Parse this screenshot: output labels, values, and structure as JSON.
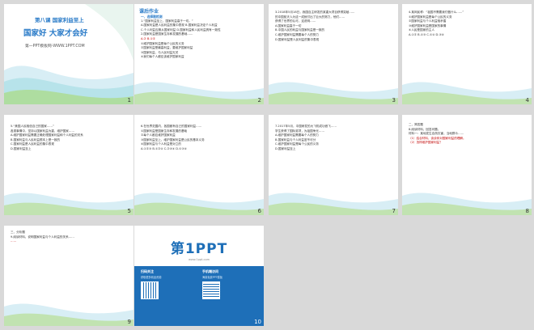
{
  "slides": [
    {
      "num": "1",
      "lesson": "第八课  国家利益至上",
      "title": "国家好  大家才会好",
      "footer": "第一PPT模板网-WWW.1PPT.COM"
    },
    {
      "num": "2",
      "section": "课后作业",
      "sub": "一、选择题检测",
      "lines": [
        "1.“国家利益至上，国家利益高于一切。”",
        "A.国家利益是人民利益的集中表现   B.国家利益决定个人利益",
        "C.个人利益应服从国家利益   D.国家利益和人民利益具有一致性",
        "2.国家利益是国家生存和发展的基础……",
        "A.②   B.①②",
        "①维护国家利益是每个公民的义务",
        "②国家利益是最高利益，要维护国家利益",
        "③国家利益，与人民利益无关",
        "④我们每个人都应该维护国家利益"
      ]
    },
    {
      "num": "3",
      "lines": [
        "3.2018年5月18日，我国自主研发的某重大项目获得突破……",
        "的中国航天人为这一成就付出了巨大的努力，他们……",
        "获得了世界的认可，这说明……",
        "A.国家利益高于一切",
        "B.中国人民的利益与国家利益是一致的",
        "C.维护国家利益需要每个人的努力",
        "D.国家利益是人民利益的集中表现"
      ]
    },
    {
      "num": "4",
      "lines": [
        "4.某网民称：“祖国不需要我们做什么……”",
        "①维护国家利益是每个公民的义务",
        "②国家利益与个人利益相矛盾",
        "③维护国家利益是国家的事情",
        "④人民是国家的主人",
        "A.①②   B.①③   C.①④   D.③④"
      ]
    },
    {
      "num": "5",
      "lines": [
        "5.“美国人民相信自己的国家……”",
        "各类事情中，坚持以国家利益为重，维护国家……",
        "A.维护国家利益需要正确处理国家利益和个人利益的关系",
        "B.国家利益与人民利益根本上是一致的",
        "C.国家利益是人民利益的集中表现",
        "D.国家利益至上"
      ]
    },
    {
      "num": "6",
      "lines": [
        "6.在世界范围内，各国都有自己的国家利益……",
        "①国家利益是国家生存和发展的基础",
        "②每个人都应维护国家利益",
        "③国家利益至上，维护国家利益是公民的基本义务",
        "④国家利益与个人利益是对立的",
        "A.①②③   B.①②④   C.②③④   D.①③④"
      ]
    },
    {
      "num": "7",
      "lines": [
        "7.2017年5月，中国研发的大飞机成功首飞……",
        "学生获得了国际奖项，为祖国争光……",
        "A.维护国家利益需要每个人的努力",
        "B.国家利益与个人利益密不可分",
        "C.维护国家利益是每个公民的义务",
        "D.国家利益至上"
      ]
    },
    {
      "num": "8",
      "lines": [
        "二、简答题",
        "8.阅读材料，回答问题。",
        "材料一：某地发生自然灾害，当地群众……",
        "（1）结合材料，谈谈你对国家利益的理解。",
        "（2）怎样维护国家利益？"
      ]
    },
    {
      "num": "9",
      "lines": [
        "三、分析题",
        "9.阅读材料，说明国家利益与个人利益的关系……",
        "……"
      ]
    },
    {
      "num": "10",
      "brand": "第1PPT",
      "brand_url": "www.1ppt.com",
      "col_left_title": "扫码关注",
      "col_left_text": "获取更多精品资源",
      "col_right_title": "手机端访问",
      "col_right_text": "海量免费PPT模板"
    }
  ],
  "colors": {
    "brand_blue": "#2a7bc8",
    "wave_teal": "#2ab6b0",
    "wave_green": "#a9d86e",
    "answer_red": "#c00000",
    "logo_bar": "#1e6fb8"
  }
}
